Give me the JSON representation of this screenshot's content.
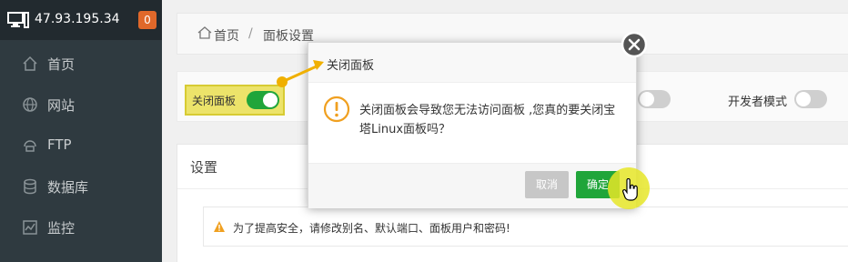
{
  "sidebar": {
    "server_ip": "47.93.195.34",
    "badge_count": "0",
    "items": [
      {
        "label": "首页",
        "icon": "home-icon"
      },
      {
        "label": "网站",
        "icon": "globe-icon"
      },
      {
        "label": "FTP",
        "icon": "ftp-icon"
      },
      {
        "label": "数据库",
        "icon": "database-icon"
      },
      {
        "label": "监控",
        "icon": "monitor-chart-icon"
      }
    ]
  },
  "breadcrumb": {
    "home": "首页",
    "separator": "/",
    "current": "面板设置"
  },
  "toggles": {
    "close_panel_label": "关闭面板",
    "close_panel_on": true,
    "dev_mode_label": "开发者模式",
    "dev_mode_on": false
  },
  "settings": {
    "title": "设置",
    "warning": "为了提高安全，请修改别名、默认端口、面板用户和密码!"
  },
  "dialog": {
    "title": "关闭面板",
    "message": "关闭面板会导致您无法访问面板 ,您真的要关闭宝塔Linux面板吗？",
    "cancel_label": "取消",
    "confirm_label": "确定"
  },
  "colors": {
    "sidebar_bg": "#2f3a40",
    "accent_green": "#20a53a",
    "badge_orange": "#e0682a",
    "highlight_yellow": "#ece36a",
    "warning_orange": "#f0a020"
  }
}
